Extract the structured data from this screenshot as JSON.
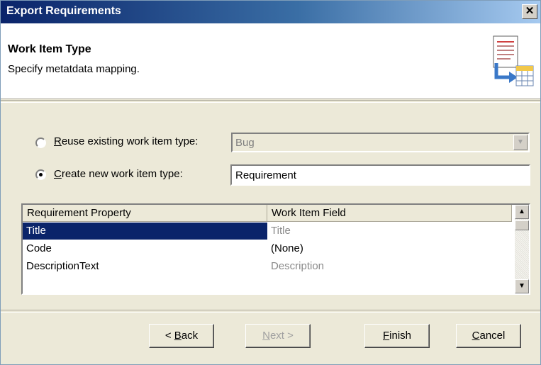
{
  "window": {
    "title": "Export Requirements",
    "close_glyph": "✕"
  },
  "header": {
    "title": "Work Item Type",
    "subtitle": "Specify metatdata mapping.",
    "icon": "document-to-table-icon"
  },
  "options": {
    "reuse": {
      "label_accel": "R",
      "label_rest": "euse existing work item type:",
      "selected": false,
      "combo_value": "Bug"
    },
    "create": {
      "label_accel": "C",
      "label_rest": "reate new work item type:",
      "selected": true,
      "text_value": "Requirement"
    }
  },
  "grid": {
    "headers": [
      "Requirement Property",
      "Work Item Field"
    ],
    "rows": [
      {
        "property": "Title",
        "field": "Title",
        "selected": true
      },
      {
        "property": "Code",
        "field": "(None)",
        "selected": false
      },
      {
        "property": "DescriptionText",
        "field": "Description",
        "selected": false
      }
    ]
  },
  "buttons": {
    "back": {
      "prefix": "< ",
      "accel": "B",
      "rest": "ack"
    },
    "next": {
      "accel": "N",
      "rest": "ext >"
    },
    "finish": {
      "accel": "F",
      "rest": "inish"
    },
    "cancel": {
      "accel": "C",
      "rest": "ancel"
    }
  },
  "colors": {
    "title_start": "#0a246a",
    "selection": "#0a246a",
    "face": "#ece9d8"
  }
}
